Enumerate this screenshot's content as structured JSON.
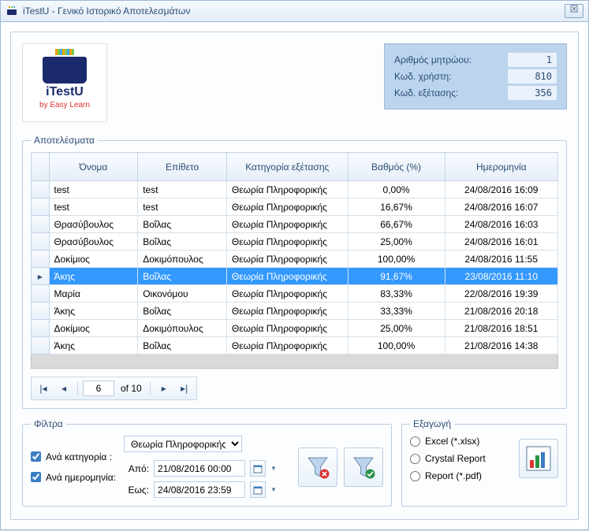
{
  "window": {
    "title": "iTestU - Γενικό Ιστορικό Αποτελεσμάτων"
  },
  "logo": {
    "title": "iTestU",
    "subtitle": "by Easy Learn"
  },
  "info": {
    "reg_label": "Αριθμός μητρώου:",
    "reg_value": "1",
    "user_label": "Κωδ. χρήστη:",
    "user_value": "810",
    "exam_label": "Κωδ. εξέτασης:",
    "exam_value": "356"
  },
  "results": {
    "legend": "Αποτελέσματα",
    "headers": {
      "rowsel": "",
      "name": "Όνομα",
      "surname": "Επίθετο",
      "category": "Κατηγορία εξέτασης",
      "grade": "Βαθμός (%)",
      "date": "Ημερομηνία"
    },
    "rows": [
      {
        "name": "test",
        "surname": "test",
        "category": "Θεωρία Πληροφορικής",
        "grade": "0,00%",
        "date": "24/08/2016 16:09",
        "selected": false
      },
      {
        "name": "test",
        "surname": "test",
        "category": "Θεωρία Πληροφορικής",
        "grade": "16,67%",
        "date": "24/08/2016 16:07",
        "selected": false
      },
      {
        "name": "Θρασύβουλος",
        "surname": "Βοΐλας",
        "category": "Θεωρία Πληροφορικής",
        "grade": "66,67%",
        "date": "24/08/2016 16:03",
        "selected": false
      },
      {
        "name": "Θρασύβουλος",
        "surname": "Βοΐλας",
        "category": "Θεωρία Πληροφορικής",
        "grade": "25,00%",
        "date": "24/08/2016 16:01",
        "selected": false
      },
      {
        "name": "Δοκίμιος",
        "surname": "Δοκιμόπουλος",
        "category": "Θεωρία Πληροφορικής",
        "grade": "100,00%",
        "date": "24/08/2016 11:55",
        "selected": false
      },
      {
        "name": "Άκης",
        "surname": "Βοΐλας",
        "category": "Θεωρία Πληροφορικής",
        "grade": "91,67%",
        "date": "23/08/2016 11:10",
        "selected": true
      },
      {
        "name": "Μαρία",
        "surname": "Οικονόμου",
        "category": "Θεωρία Πληροφορικής",
        "grade": "83,33%",
        "date": "22/08/2016 19:39",
        "selected": false
      },
      {
        "name": "Άκης",
        "surname": "Βοΐλας",
        "category": "Θεωρία Πληροφορικής",
        "grade": "33,33%",
        "date": "21/08/2016 20:18",
        "selected": false
      },
      {
        "name": "Δοκίμιος",
        "surname": "Δοκιμόπουλος",
        "category": "Θεωρία Πληροφορικής",
        "grade": "25,00%",
        "date": "21/08/2016 18:51",
        "selected": false
      },
      {
        "name": "Άκης",
        "surname": "Βοΐλας",
        "category": "Θεωρία Πληροφορικής",
        "grade": "100,00%",
        "date": "21/08/2016 14:38",
        "selected": false
      }
    ]
  },
  "pager": {
    "current": "6",
    "of_text": "of 10"
  },
  "filters": {
    "legend": "Φίλτρα",
    "by_category_label": "Ανά κατηγορία :",
    "category_value": "Θεωρία Πληροφορικής",
    "by_date_label": "Ανά ημερομηνία:",
    "from_label": "Από:",
    "from_value": "21/08/2016 00:00",
    "to_label": "Εως:",
    "to_value": "24/08/2016 23:59"
  },
  "export": {
    "legend": "Εξαγωγή",
    "excel": "Excel (*.xlsx)",
    "crystal": "Crystal Report",
    "pdf": "Report (*.pdf)"
  }
}
